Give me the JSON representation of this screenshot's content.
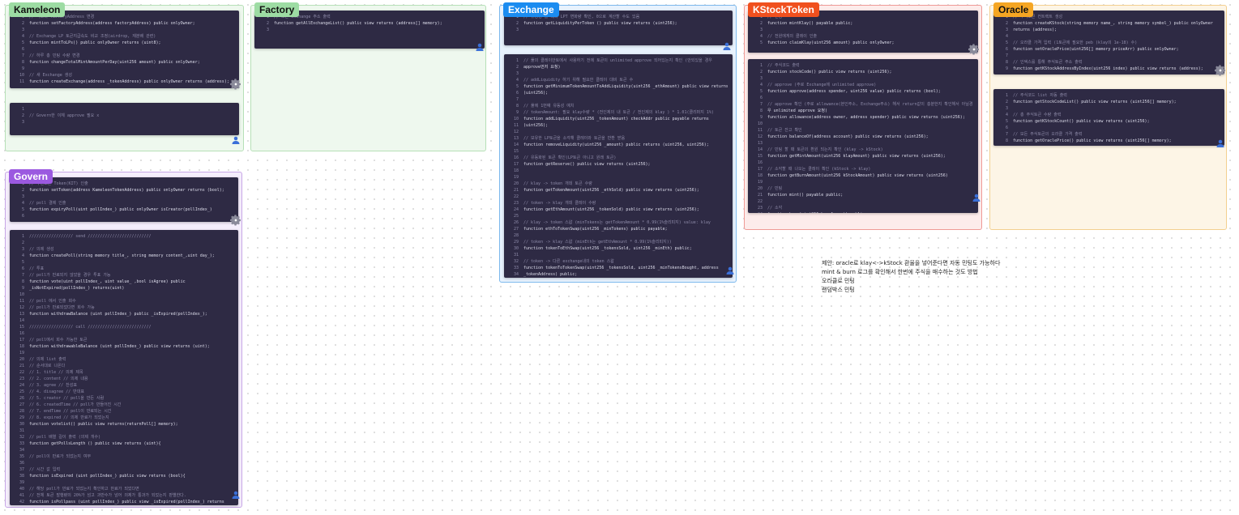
{
  "colors": {
    "panel_bg": "#2e2a44",
    "keyword": "#43b4e6",
    "comment": "#8d8aa8",
    "code": "#dcdcea"
  },
  "frames": [
    {
      "id": "kameleon",
      "title": "Kameleon",
      "border": "#b6e0b7",
      "fill": "#eef8ee",
      "label_bg": "#9ddca3",
      "label_fg": "#111111",
      "panels": [
        {
          "lines": [
            {
              "n": "1",
              "t": "// 팩토리 factoryAddress 변경"
            },
            {
              "n": "2",
              "t": "function setFactoryAddress(address factoryAddress) public onlyOwner;"
            },
            {
              "n": "3",
              "t": ""
            },
            {
              "n": "4",
              "t": "// Exchange LP 토큰지급속도 비교 조정(airdrop, 재분배 관련)"
            },
            {
              "n": "5",
              "t": "function mintToLPs() public onlyOwner returns (uint8);"
            },
            {
              "n": "6",
              "t": ""
            },
            {
              "n": "7",
              "t": "// 하루 총 민팅 수량 변경"
            },
            {
              "n": "8",
              "t": "function changeTotalMintAmountPerDay(uint256 amount) public onlyOwner;"
            },
            {
              "n": "9",
              "t": ""
            },
            {
              "n": "10",
              "t": "// 새 Exchange 생성"
            },
            {
              "n": "11",
              "t": "function createExchange(address _tokenAddress) public onlyOwner returns (address);"
            }
          ]
        },
        {
          "lines": [
            {
              "n": "1",
              "t": ""
            },
            {
              "n": "2",
              "t": "// Govern한 이체 approve 필요 x"
            },
            {
              "n": "3",
              "t": ""
            }
          ]
        }
      ]
    },
    {
      "id": "factory",
      "title": "Factory",
      "border": "#b6e0b7",
      "fill": "#eef8ee",
      "label_bg": "#9ddca3",
      "label_fg": "#111111",
      "panels": [
        {
          "lines": [
            {
              "n": "1",
              "t": "// 모든 exchange 주소 출력"
            },
            {
              "n": "2",
              "t": "function getAllExchangeList() public view returns (address[] memory);"
            },
            {
              "n": "3",
              "t": ""
            }
          ]
        }
      ]
    },
    {
      "id": "exchange",
      "title": "Exchange",
      "border": "#7cb8ec",
      "fill": "#e8f2fd",
      "label_bg": "#1b8cf0",
      "label_fg": "#ffffff",
      "panels": [
        {
          "lines": [
            {
              "n": "1",
              "t": "// 유동성 풀 대비 LPT 변화량 확인, 0으로 계산할 수도 있음"
            },
            {
              "n": "2",
              "t": "function getLiquidityPerToken () public view returns (uint256);"
            },
            {
              "n": "3",
              "t": ""
            }
          ]
        },
        {
          "lines": [
            {
              "n": "1",
              "t": "// 풀의 클레이안토에서 사용하기 전에 토큰이 unlimited approve 되어있는지 확인 (안되있을 경우"
            },
            {
              "n": "2",
              "t": "approve먼저 요청)"
            },
            {
              "n": "3",
              "t": ""
            },
            {
              "n": "4",
              "t": "// addLiquidity 하기 위해 필요한 클레이 대비 토큰 수"
            },
            {
              "n": "5",
              "t": "function getMinimumTokenAmountToAddLiquidity(uint256 _ethAmount) public view returns"
            },
            {
              "n": "6",
              "t": "(uint256);"
            },
            {
              "n": "7",
              "t": ""
            },
            {
              "n": "8",
              "t": "// 풀에 1번째 유동성 예치"
            },
            {
              "n": "9",
              "t": "// tokenAmount: 필요 klay수량 * (전인제의 내 토큰 / 전인제의 klay ) * 1.01(클리퍼지 1%)"
            },
            {
              "n": "10",
              "t": "function addLiquidity(uint256 _tokenAmount) checkAddr public payable returns"
            },
            {
              "n": "11",
              "t": "(uint256);"
            },
            {
              "n": "12",
              "t": ""
            },
            {
              "n": "13",
              "t": "// 보유한 LP토큰을 소각해 클레이와 토큰을 반환 받음"
            },
            {
              "n": "14",
              "t": "function removeLiquidity(uint256 _amount) public returns (uint256, uint256);"
            },
            {
              "n": "15",
              "t": ""
            },
            {
              "n": "16",
              "t": "// 유동화된 토큰 확인(LP토큰 아니고 원래 토큰)"
            },
            {
              "n": "17",
              "t": "function getReserve() public view returns (uint256);"
            },
            {
              "n": "18",
              "t": ""
            },
            {
              "n": "19",
              "t": ""
            },
            {
              "n": "20",
              "t": "// klay -> token 개데 토큰 수량"
            },
            {
              "n": "21",
              "t": "function getTokenAmount(uint256 _ethSold) public view returns (uint256);"
            },
            {
              "n": "22",
              "t": ""
            },
            {
              "n": "23",
              "t": "// token -> klay 개데 클레이 수량"
            },
            {
              "n": "24",
              "t": "function getEthAmount(uint256 _tokenSold) public view returns (uint256);"
            },
            {
              "n": "25",
              "t": ""
            },
            {
              "n": "26",
              "t": "// klay -> token 스왑 (minTokens는 getTokenAmount * 0.99(1%슬리피지) value: klay"
            },
            {
              "n": "27",
              "t": "function ethToTokenSwap(uint256 _minTokens) public payable;"
            },
            {
              "n": "28",
              "t": ""
            },
            {
              "n": "29",
              "t": "// token -> klay 스왑 (minEth는 getEthAmount * 0.99(1%슬리피지))"
            },
            {
              "n": "30",
              "t": "function tokenToEthSwap(uint256 _tokensSold, uint256 _minEth) public;"
            },
            {
              "n": "31",
              "t": ""
            },
            {
              "n": "32",
              "t": "// token -> 다른 exchange내의 token 스왑"
            },
            {
              "n": "33",
              "t": "function tokenToTokenSwap(uint256 _tokensSold, uint256 _minTokensBought, address"
            },
            {
              "n": "34",
              "t": "_tokenAddress) public;"
            }
          ]
        }
      ]
    },
    {
      "id": "kstock",
      "title": "KStockToken",
      "border": "#ef9a96",
      "fill": "#fdeceb",
      "label_bg": "#f0501e",
      "label_fg": "#ffffff",
      "panels": [
        {
          "lines": [
            {
              "n": "1",
              "t": "// 민팅"
            },
            {
              "n": "2",
              "t": "function mintKlay() payable public;"
            },
            {
              "n": "3",
              "t": ""
            },
            {
              "n": "4",
              "t": "// 전원에게의 클레이 인출"
            },
            {
              "n": "5",
              "t": "function claimKlay(uint256 amount) public onlyOwner;"
            }
          ]
        },
        {
          "lines": [
            {
              "n": "1",
              "t": "// 주식코드 출력"
            },
            {
              "n": "2",
              "t": "function stockCode() public view returns (uint256);"
            },
            {
              "n": "3",
              "t": ""
            },
            {
              "n": "4",
              "t": "// approve (주로 Exchange에 unlimited approve)"
            },
            {
              "n": "5",
              "t": "function approve(address spender, uint256 value) public returns (bool);"
            },
            {
              "n": "6",
              "t": ""
            },
            {
              "n": "7",
              "t": "// approve 확인 (주로 allowance(본인주소, Exchange주소) 해서 return값이 충분한지 확인해서 아닐경"
            },
            {
              "n": "8",
              "t": "우 unlimited approve 요청)"
            },
            {
              "n": "9",
              "t": "function allowance(address owner, address spender) public view returns (uint256);"
            },
            {
              "n": "10",
              "t": ""
            },
            {
              "n": "11",
              "t": "// 토큰 잔고 확인"
            },
            {
              "n": "12",
              "t": "function balanceOf(address account) public view returns (uint256);"
            },
            {
              "n": "13",
              "t": ""
            },
            {
              "n": "14",
              "t": "// 민팅 할 때 토큰의 환원 되는지 확인 (klay -> kStock)"
            },
            {
              "n": "15",
              "t": "function getMintAmount(uint256 klayAmount) public view returns (uint256);"
            },
            {
              "n": "16",
              "t": ""
            },
            {
              "n": "17",
              "t": "// 소각할 때 나오는 클레이 확인 (kStock -> klay)"
            },
            {
              "n": "18",
              "t": "function getBurnAmount(uint256 kStockAmount) public view returns (uint256)"
            },
            {
              "n": "19",
              "t": ""
            },
            {
              "n": "20",
              "t": "// 민팅"
            },
            {
              "n": "21",
              "t": "function mint() payable public;"
            },
            {
              "n": "22",
              "t": ""
            },
            {
              "n": "23",
              "t": "// 소각"
            },
            {
              "n": "24",
              "t": "function burn(uint256 burnAmount) public;"
            }
          ]
        }
      ]
    },
    {
      "id": "oracle",
      "title": "Oracle",
      "border": "#f3cf8f",
      "fill": "#fdf5e6",
      "label_bg": "#f5a623",
      "label_fg": "#111111",
      "panels": [
        {
          "lines": [
            {
              "n": "1",
              "t": "// 주식토큰 컨트랙트 생성"
            },
            {
              "n": "2",
              "t": "function createKStock(string memory name_, string memory symbol_) public onlyOwner"
            },
            {
              "n": "3",
              "t": "returns (address);"
            },
            {
              "n": "4",
              "t": ""
            },
            {
              "n": "5",
              "t": "// 오라클 가격 입력 (1토큰에 필요한 peb (klay의 1e-18) 수)"
            },
            {
              "n": "6",
              "t": "function setOraclePrice(uint256[] memory priceArr) public onlyOwner;"
            },
            {
              "n": "7",
              "t": ""
            },
            {
              "n": "8",
              "t": "// 인덱스를 통해 주식토큰 주소 출력"
            },
            {
              "n": "9",
              "t": "function getKStockAddressByIndex(uint256 index) public view returns (address);"
            }
          ]
        },
        {
          "lines": [
            {
              "n": "1",
              "t": "// 주식코드 list 자동 출력"
            },
            {
              "n": "2",
              "t": "function getStockCodeList() public view returns (uint256[] memory);"
            },
            {
              "n": "3",
              "t": ""
            },
            {
              "n": "4",
              "t": "// 총 주식토큰 수량 출력"
            },
            {
              "n": "5",
              "t": "function getKStockCount() public view returns (uint256);"
            },
            {
              "n": "6",
              "t": ""
            },
            {
              "n": "7",
              "t": "// 모든 주식토큰의 오라클 가격 출력"
            },
            {
              "n": "8",
              "t": "function getOraclePrice() public view returns (uint256[] memory);"
            }
          ]
        }
      ]
    },
    {
      "id": "govern",
      "title": "Govern",
      "border": "#c7a6e6",
      "fill": "#f5eefc",
      "label_bg": "#9b59e0",
      "label_fg": "#ffffff",
      "panels": [
        {
          "lines": [
            {
              "n": "1",
              "t": "// 추천토큰 Token(KIT) 인출"
            },
            {
              "n": "2",
              "t": "function setToken(address KameleonTokenAddress) public onlyOwner returns (bool);"
            },
            {
              "n": "3",
              "t": ""
            },
            {
              "n": "4",
              "t": "// poll 결제 인출"
            },
            {
              "n": "5",
              "t": "function expiryPoll(uint pollIndex_) public onlyOwner isCreator(pollIndex_)"
            },
            {
              "n": "6",
              "t": ""
            }
          ]
        },
        {
          "lines": [
            {
              "n": "1",
              "t": "////////////////// send //////////////////////////"
            },
            {
              "n": "2",
              "t": ""
            },
            {
              "n": "3",
              "t": "// 의제 생성"
            },
            {
              "n": "4",
              "t": "function createPoll(string memory title_, string memory content_,uint day_);"
            },
            {
              "n": "5",
              "t": ""
            },
            {
              "n": "6",
              "t": "// 투표"
            },
            {
              "n": "7",
              "t": "// poll가 만료되지 않았을 경우 투표 가능"
            },
            {
              "n": "8",
              "t": "function vote(uint pollIndex_, uint value_ ,bool isAgree) public"
            },
            {
              "n": "9",
              "t": "_isNotExpired(pollIndex_) returns(uint)"
            },
            {
              "n": "10",
              "t": ""
            },
            {
              "n": "11",
              "t": "// poll 에서 인출 회수"
            },
            {
              "n": "12",
              "t": "// poll가 만료되었다면 회수 가능"
            },
            {
              "n": "13",
              "t": "function withdrawBalance (uint pollIndex_) public _isExpired(pollIndex_);"
            },
            {
              "n": "14",
              "t": ""
            },
            {
              "n": "15",
              "t": "////////////////// call //////////////////////////"
            },
            {
              "n": "16",
              "t": ""
            },
            {
              "n": "17",
              "t": "// poll에서 회수 가능한 토큰"
            },
            {
              "n": "18",
              "t": "function withdrawableBalance (uint pollIndex_) public view returns (uint);"
            },
            {
              "n": "19",
              "t": ""
            },
            {
              "n": "20",
              "t": "// 의제 list 출력"
            },
            {
              "n": "21",
              "t": "// 순서대로 나온다"
            },
            {
              "n": "22",
              "t": "// 1. title // 의제 제목"
            },
            {
              "n": "23",
              "t": "// 2. content // 의제 내용"
            },
            {
              "n": "24",
              "t": "// 3. agree // 찬성표"
            },
            {
              "n": "25",
              "t": "// 4. disagree // 반대표"
            },
            {
              "n": "26",
              "t": "// 5. creator // poll을 만든 사람"
            },
            {
              "n": "27",
              "t": "// 6. createdTime // poll가 만들어진 시간"
            },
            {
              "n": "28",
              "t": "// 7. endTime // poll이 만료되는 시간"
            },
            {
              "n": "29",
              "t": "// 8. expired // 의제 만료가 되었는지"
            },
            {
              "n": "30",
              "t": "function votelist() public view returns(returnPoll[] memory);"
            },
            {
              "n": "31",
              "t": ""
            },
            {
              "n": "32",
              "t": "// poll 배열 길이 출력 (의제 개수)"
            },
            {
              "n": "33",
              "t": "function getPollsLength () public view returns (uint){"
            },
            {
              "n": "34",
              "t": ""
            },
            {
              "n": "35",
              "t": "// poll이 만료가 되었는지 여부"
            },
            {
              "n": "36",
              "t": ""
            },
            {
              "n": "37",
              "t": "// 시간 값 입력"
            },
            {
              "n": "38",
              "t": "function isExpired (uint pollIndex_) public view returns (bool){"
            },
            {
              "n": "39",
              "t": ""
            },
            {
              "n": "40",
              "t": "// 해당 poll가 만료가 되었는지 확인하고 만료가 되었다면"
            },
            {
              "n": "41",
              "t": "// 전체 토큰 발행량의 20%가 넘고 과반수가 넘어 의제가 통과가 되었는지 판별한다."
            },
            {
              "n": "42",
              "t": "function isPollpass (uint pollIndex_) public view _isExpired(pollIndex_) returns"
            },
            {
              "n": "43",
              "t": "(bool)"
            },
            {
              "n": "44",
              "t": ""
            }
          ]
        }
      ]
    }
  ],
  "note": {
    "lines": [
      "제안: oracle로 klay<->kStock 환율을 넣어준다면 자동 민팅도 가능하다",
      "mint & burn 로그를 확인해서 한번에 주식을 매수하는 것도 방법",
      "오라클로 민팅",
      "랜덤박스 민팅"
    ]
  }
}
